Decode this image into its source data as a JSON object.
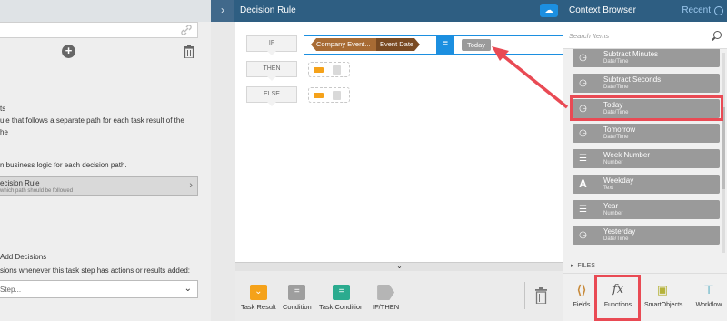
{
  "left": {
    "lines": [
      "ts",
      "ule that follows a separate path for each task result of the",
      "he",
      "n business logic for each decision path."
    ],
    "rule_title": "ecision Rule",
    "rule_sub": "which path should be followed",
    "add_decisions": "Add Decisions",
    "add_decisions_desc": "sions whenever this task step has actions or results added:",
    "select_value": "Step..."
  },
  "editor": {
    "title": "Decision Rule",
    "expand_icon": "chevron-right-icon",
    "steps": [
      "IF",
      "THEN",
      "ELSE"
    ],
    "condition": {
      "left_field": "Company Event...",
      "left_sub": "Event Date",
      "operator": "=",
      "right_value": "Today"
    }
  },
  "toolbar": {
    "tools": [
      {
        "label": "Task Result",
        "icon": "task-result-icon",
        "color": "#f5a21a"
      },
      {
        "label": "Condition",
        "icon": "condition-icon",
        "color": "#9e9e9e"
      },
      {
        "label": "Task Condition",
        "icon": "task-condition-icon",
        "color": "#2bab8f"
      },
      {
        "label": "IF/THEN",
        "icon": "if-then-icon",
        "color": "#b5b5b5"
      }
    ]
  },
  "context_browser": {
    "title": "Context Browser",
    "recent_label": "Recent",
    "search_placeholder": "Search Items",
    "items": [
      {
        "name": "Subtract Minutes",
        "type": "Date/Time",
        "icon": "datetime-icon"
      },
      {
        "name": "Subtract Seconds",
        "type": "Date/Time",
        "icon": "datetime-icon"
      },
      {
        "name": "Today",
        "type": "Date/Time",
        "icon": "datetime-icon"
      },
      {
        "name": "Tomorrow",
        "type": "Date/Time",
        "icon": "datetime-icon"
      },
      {
        "name": "Week Number",
        "type": "Number",
        "icon": "number-icon"
      },
      {
        "name": "Weekday",
        "type": "Text",
        "icon": "text-icon"
      },
      {
        "name": "Year",
        "type": "Number",
        "icon": "number-icon"
      },
      {
        "name": "Yesterday",
        "type": "Date/Time",
        "icon": "datetime-icon"
      }
    ],
    "files_label": "FILES",
    "tabs": [
      {
        "label": "Fields",
        "icon": "fields-icon"
      },
      {
        "label": "Functions",
        "icon": "functions-icon"
      },
      {
        "label": "SmartObjects",
        "icon": "smartobjects-icon"
      },
      {
        "label": "Workflow",
        "icon": "workflow-icon"
      }
    ]
  },
  "colors": {
    "header_blue": "#2e5e82",
    "accent_blue": "#1c8fe0",
    "annotation_red": "#e94a54"
  }
}
